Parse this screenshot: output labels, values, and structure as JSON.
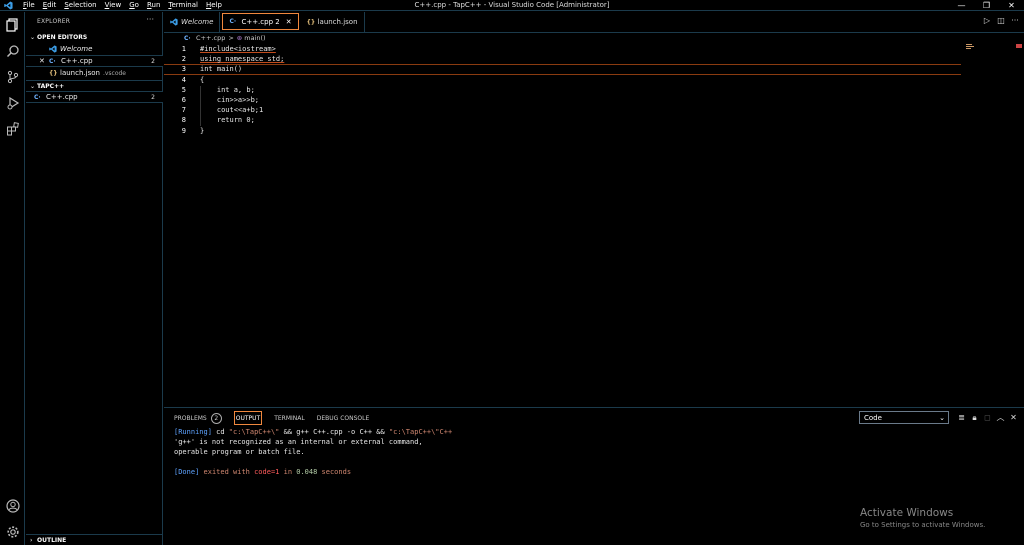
{
  "menu": [
    "File",
    "Edit",
    "Selection",
    "View",
    "Go",
    "Run",
    "Terminal",
    "Help"
  ],
  "window_title": "C++.cpp - TapC++ - Visual Studio Code [Administrator]",
  "window_controls": {
    "minimize": "—",
    "restore": "❐",
    "close": "✕"
  },
  "sidebar": {
    "header": "EXPLORER",
    "more": "···",
    "open_editors": {
      "title": "OPEN EDITORS",
      "items": [
        {
          "label": "Welcome",
          "icon": "vscode-icon"
        },
        {
          "label": "C++.cpp",
          "icon": "cpp-icon",
          "badge": "2",
          "close": "✕"
        },
        {
          "label": "launch.json",
          "icon": "json-icon",
          "path": ".vscode"
        }
      ]
    },
    "workspace": {
      "title": "TAPC++",
      "items": [
        {
          "label": "C++.cpp",
          "icon": "cpp-icon",
          "badge": "2"
        }
      ]
    },
    "outline": "OUTLINE"
  },
  "tabs": [
    {
      "label": "Welcome",
      "icon": "vscode-icon"
    },
    {
      "label": "C++.cpp 2",
      "icon": "cpp-icon",
      "close": "✕",
      "active": true
    },
    {
      "label": "launch.json",
      "icon": "json-icon"
    }
  ],
  "breadcrumb": {
    "file": "C++.cpp",
    "sep": ">",
    "symbol": "main()"
  },
  "code_lines": [
    {
      "n": "1",
      "text": "#include<iostream>"
    },
    {
      "n": "2",
      "text": "using namespace std;"
    },
    {
      "n": "3",
      "text": "int main()"
    },
    {
      "n": "4",
      "text": "{"
    },
    {
      "n": "5",
      "text": "    int a, b;"
    },
    {
      "n": "6",
      "text": "    cin>>a>>b;"
    },
    {
      "n": "7",
      "text": "    cout<<a+b;1"
    },
    {
      "n": "8",
      "text": "    return 0;"
    },
    {
      "n": "9",
      "text": "}"
    }
  ],
  "panel": {
    "tabs": {
      "problems": "PROBLEMS",
      "problems_count": "2",
      "output": "OUTPUT",
      "terminal": "TERMINAL",
      "debug": "DEBUG CONSOLE"
    },
    "output_channel": "Code",
    "output": {
      "line1_tag": "[Running]",
      "line1_cmd1": " cd ",
      "line1_str1": "\"c:\\TapC++\\\"",
      "line1_cmd2": " && g++ C++.cpp -o C++ && ",
      "line1_str2": "\"c:\\TapC++\\\"C++",
      "line2": "'g++' is not recognized as an internal or external command,",
      "line3": "operable program or batch file.",
      "line5_tag": "[Done]",
      "line5_a": " exited with ",
      "line5_code": "code=1",
      "line5_b": " in ",
      "line5_time": "0.048",
      "line5_c": " seconds"
    }
  },
  "watermark": {
    "title": "Activate Windows",
    "subtitle": "Go to Settings to activate Windows."
  },
  "colors": {
    "accent": "#f0883e",
    "border": "#1b3a4b",
    "keyword": "#e07b53"
  }
}
